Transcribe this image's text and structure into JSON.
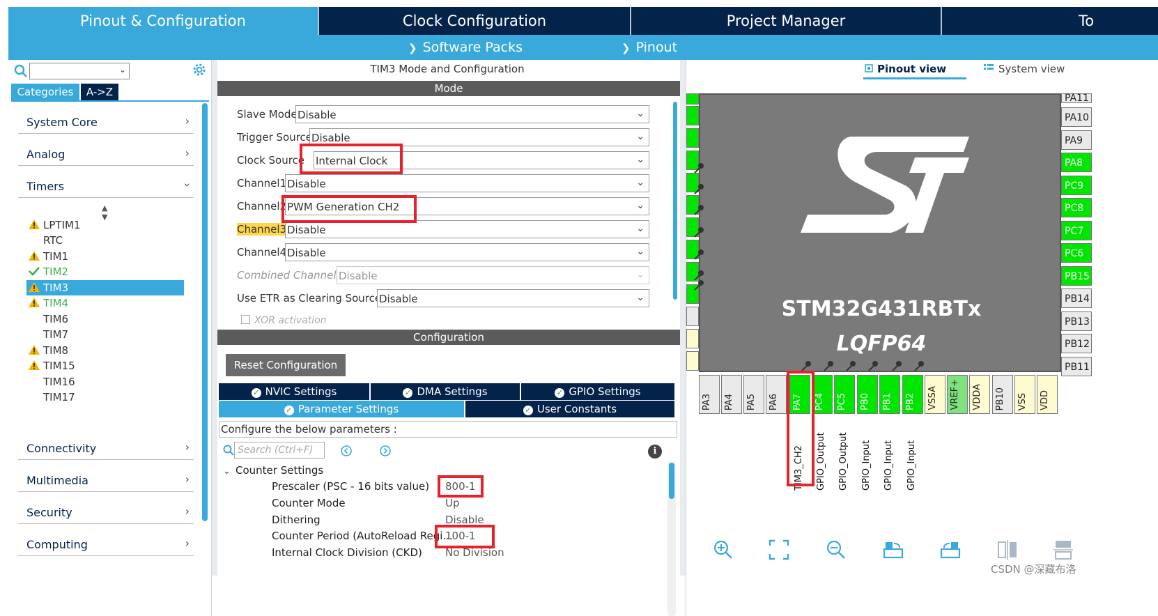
{
  "top_tabs": [
    "Pinout & Configuration",
    "Clock Configuration",
    "Project Manager",
    "To"
  ],
  "sub_bar": {
    "software_packs": "Software Packs",
    "pinout": "Pinout"
  },
  "left": {
    "tab_categories": "Categories",
    "tab_az": "A->Z",
    "categories": [
      {
        "label": "System Core"
      },
      {
        "label": "Analog"
      },
      {
        "label": "Timers"
      },
      {
        "label": "Connectivity"
      },
      {
        "label": "Multimedia"
      },
      {
        "label": "Security"
      },
      {
        "label": "Computing"
      }
    ],
    "timers": [
      {
        "label": "LPTIM1",
        "status": "warning"
      },
      {
        "label": "RTC",
        "status": "none"
      },
      {
        "label": "TIM1",
        "status": "warning"
      },
      {
        "label": "TIM2",
        "status": "ok"
      },
      {
        "label": "TIM3",
        "status": "warning",
        "selected": true
      },
      {
        "label": "TIM4",
        "status": "warning"
      },
      {
        "label": "TIM6",
        "status": "none"
      },
      {
        "label": "TIM7",
        "status": "none"
      },
      {
        "label": "TIM8",
        "status": "warning"
      },
      {
        "label": "TIM15",
        "status": "warning"
      },
      {
        "label": "TIM16",
        "status": "none"
      },
      {
        "label": "TIM17",
        "status": "none"
      }
    ]
  },
  "mid": {
    "title": "TIM3 Mode and Configuration",
    "mode_header": "Mode",
    "mode_rows": [
      {
        "label": "Slave Mode",
        "value": "Disable"
      },
      {
        "label": "Trigger Source",
        "value": "Disable"
      },
      {
        "label": "Clock Source",
        "value": "Internal Clock"
      },
      {
        "label": "Channel1",
        "value": "Disable"
      },
      {
        "label": "Channel2",
        "value": "PWM Generation CH2"
      },
      {
        "label": "Channel3",
        "value": "Disable"
      },
      {
        "label": "Channel4",
        "value": "Disable"
      },
      {
        "label": "Combined Channels",
        "value": "Disable"
      },
      {
        "label": "Use ETR as Clearing Source",
        "value": "Disable"
      }
    ],
    "xor_label": "XOR activation",
    "config_header": "Configuration",
    "reset_button": "Reset Configuration",
    "tabs_row1": [
      "NVIC Settings",
      "DMA Settings",
      "GPIO Settings"
    ],
    "tabs_row2": [
      "Parameter Settings",
      "User Constants"
    ],
    "param_hint": "Configure the below parameters :",
    "search_placeholder": "Search (Ctrl+F)",
    "group": "Counter Settings",
    "params": [
      {
        "name": "Prescaler (PSC - 16 bits value)",
        "value": "800-1"
      },
      {
        "name": "Counter Mode",
        "value": "Up"
      },
      {
        "name": "Dithering",
        "value": "Disable"
      },
      {
        "name": "Counter Period (AutoReload Regi...",
        "value": "100-1"
      },
      {
        "name": "Internal Clock Division (CKD)",
        "value": "No Division"
      }
    ]
  },
  "right": {
    "pinout_view": "Pinout view",
    "system_view": "System view",
    "chip_name": "STM32G431RBTx",
    "package": "LQFP64",
    "right_pins": [
      {
        "label": "PA11",
        "green": false
      },
      {
        "label": "PA10",
        "green": false
      },
      {
        "label": "PA9",
        "green": false
      },
      {
        "label": "PA8",
        "green": true
      },
      {
        "label": "PC9",
        "green": true
      },
      {
        "label": "PC8",
        "green": true
      },
      {
        "label": "PC7",
        "green": true
      },
      {
        "label": "PC6",
        "green": true
      },
      {
        "label": "PB15",
        "green": true
      },
      {
        "label": "PB14",
        "green": false
      },
      {
        "label": "PB13",
        "green": false
      },
      {
        "label": "PB12",
        "green": false
      },
      {
        "label": "PB11",
        "green": false
      }
    ],
    "bottom_pins": [
      {
        "label": "PA3",
        "kind": "gray",
        "func": ""
      },
      {
        "label": "PA4",
        "kind": "gray",
        "func": ""
      },
      {
        "label": "PA5",
        "kind": "gray",
        "func": ""
      },
      {
        "label": "PA6",
        "kind": "gray",
        "func": ""
      },
      {
        "label": "PA7",
        "kind": "green",
        "func": "TIM3_CH2"
      },
      {
        "label": "PC4",
        "kind": "green",
        "func": "GPIO_Output"
      },
      {
        "label": "PC5",
        "kind": "green",
        "func": "GPIO_Output"
      },
      {
        "label": "PB0",
        "kind": "green",
        "func": "GPIO_Input"
      },
      {
        "label": "PB1",
        "kind": "green",
        "func": "GPIO_Input"
      },
      {
        "label": "PB2",
        "kind": "green",
        "func": "GPIO_Input"
      },
      {
        "label": "VSSA",
        "kind": "pale",
        "func": ""
      },
      {
        "label": "VREF+",
        "kind": "lightgreen",
        "func": ""
      },
      {
        "label": "VDDA",
        "kind": "pale",
        "func": ""
      },
      {
        "label": "PB10",
        "kind": "gray",
        "func": ""
      },
      {
        "label": "VSS",
        "kind": "pale",
        "func": ""
      },
      {
        "label": "VDD",
        "kind": "pale",
        "func": ""
      }
    ]
  },
  "watermark": "CSDN @深藏布洛",
  "colors": {
    "navy": "#03234b",
    "accent": "#39a9dc",
    "pin_green": "#00e600",
    "highlight_red": "#e8222b"
  }
}
